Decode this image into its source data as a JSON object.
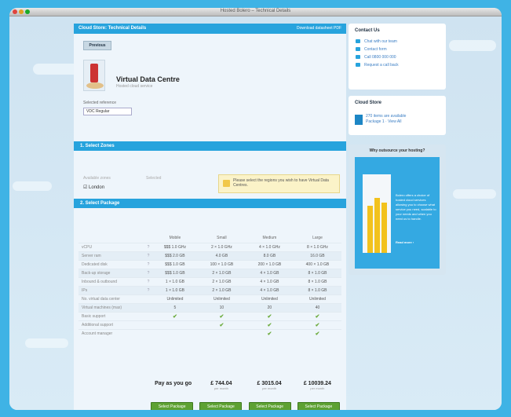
{
  "window": {
    "title": "Hosted Bolero – Technical Details"
  },
  "header": {
    "title": "Cloud Store: Technical Details",
    "link": "Download datasheet PDF"
  },
  "previous_label": "Previous",
  "product": {
    "name": "Virtual Data Centre",
    "subtitle": "Hosted cloud service"
  },
  "selection": {
    "label": "Selected reference",
    "value": "VDC Regular"
  },
  "zone_section": {
    "title": "1. Select Zones",
    "col1": "Available zones",
    "col2": "Selected",
    "checkbox_label": "London",
    "note": "Please select the regions you wish to have Virtual Data Centres."
  },
  "package_section": {
    "title": "2. Select Package",
    "columns": [
      "Mobile",
      "Small",
      "Medium",
      "Large"
    ],
    "rows": [
      {
        "label": "vCPU",
        "q": "?",
        "cells": [
          "$$$ 1.0 GHz",
          "2 × 1.0 GHz",
          "4 × 1.0 GHz",
          "8 × 1.0 GHz"
        ],
        "shaded": false
      },
      {
        "label": "Server ram",
        "q": "?",
        "cells": [
          "$$$ 2.0 GB",
          "4.0 GB",
          "8.0 GB",
          "16.0 GB"
        ],
        "shaded": true
      },
      {
        "label": "Dedicated disk",
        "q": "?",
        "cells": [
          "$$$ 1.0 GB",
          "100 × 1.0 GB",
          "200 × 1.0 GB",
          "400 × 1.0 GB"
        ],
        "shaded": false
      },
      {
        "label": "Back-up storage",
        "q": "?",
        "cells": [
          "$$$ 1.0 GB",
          "2 × 1.0 GB",
          "4 × 1.0 GB",
          "8 × 1.0 GB"
        ],
        "shaded": true
      },
      {
        "label": "Inbound & outbound",
        "q": "?",
        "cells": [
          "1 × 1.0 GB",
          "2 × 1.0 GB",
          "4 × 1.0 GB",
          "8 × 1.0 GB"
        ],
        "shaded": false
      },
      {
        "label": "IPs",
        "q": "?",
        "cells": [
          "1 × 1.0 GB",
          "2 × 1.0 GB",
          "4 × 1.0 GB",
          "8 × 1.0 GB"
        ],
        "shaded": true
      },
      {
        "label": "No. virtual data center",
        "q": "",
        "cells": [
          "Unlimited",
          "Unlimited",
          "Unlimited",
          "Unlimited"
        ],
        "shaded": false
      },
      {
        "label": "Virtual machines (max)",
        "q": "",
        "cells": [
          "5",
          "10",
          "20",
          "40"
        ],
        "shaded": true
      }
    ],
    "feature_rows": [
      {
        "label": "Basic support",
        "ticks": [
          true,
          true,
          true,
          true
        ]
      },
      {
        "label": "Additional support",
        "ticks": [
          false,
          true,
          true,
          true
        ]
      },
      {
        "label": "Account manager",
        "ticks": [
          false,
          false,
          true,
          true
        ]
      }
    ],
    "prices": [
      {
        "price": "Pay as you go",
        "unit": ""
      },
      {
        "price": "£ 744.04",
        "unit": "per month"
      },
      {
        "price": "£ 3015.04",
        "unit": "per month"
      },
      {
        "price": "£ 10039.24",
        "unit": "per month"
      }
    ],
    "buttons": [
      "Select Package",
      "Select Package",
      "Select Package",
      "Select Package"
    ]
  },
  "contact": {
    "title": "Contact Us",
    "links": [
      "Chat with our team",
      "Contact form",
      "Call 0800 000 000",
      "Request a call back"
    ]
  },
  "store": {
    "title": "Cloud Store",
    "text": "270 items are available",
    "sub": "Package 1 · View All"
  },
  "why": {
    "title": "Why outsource your hosting?",
    "text": "Bolero offers a choice of hosted cloud services allowing you to choose what service you need, scalable to your needs and when you need us to handle.",
    "more": "Read more ›"
  },
  "colors": {
    "accent": "#27a3dd",
    "button_green": "#5da132",
    "background": "#3fb3e5"
  }
}
